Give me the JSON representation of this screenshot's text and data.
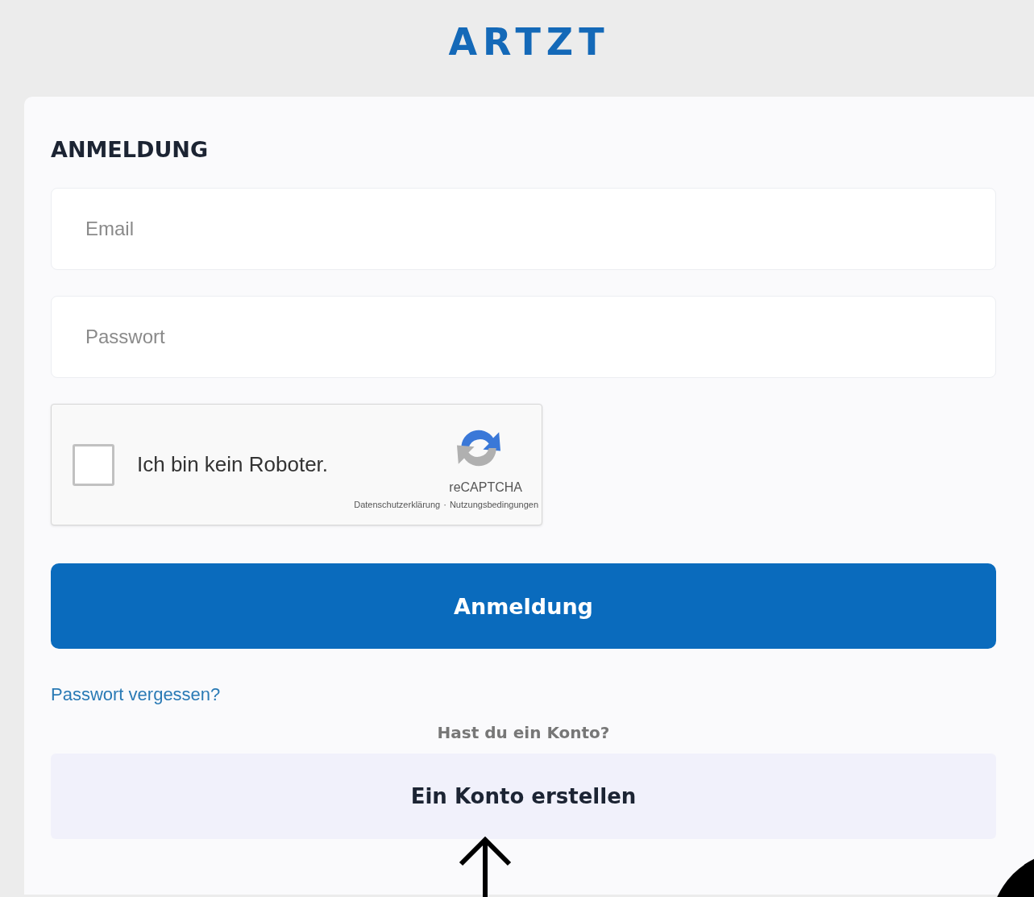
{
  "logo": "ARTZT",
  "heading": "ANMELDUNG",
  "fields": [
    {
      "placeholder": "Email"
    },
    {
      "placeholder": "Passwort"
    }
  ],
  "captcha": {
    "label": "Ich bin kein Roboter.",
    "checked": false,
    "brand": "reCAPTCHA",
    "privacy": "Datenschutzerklärung",
    "separator": "·",
    "terms": "Nutzungsbedingungen"
  },
  "submit": "Anmeldung",
  "forgot": "Passwort vergessen?",
  "account_prompt": "Hast du ein Konto?",
  "create_account": "Ein Konto erstellen"
}
